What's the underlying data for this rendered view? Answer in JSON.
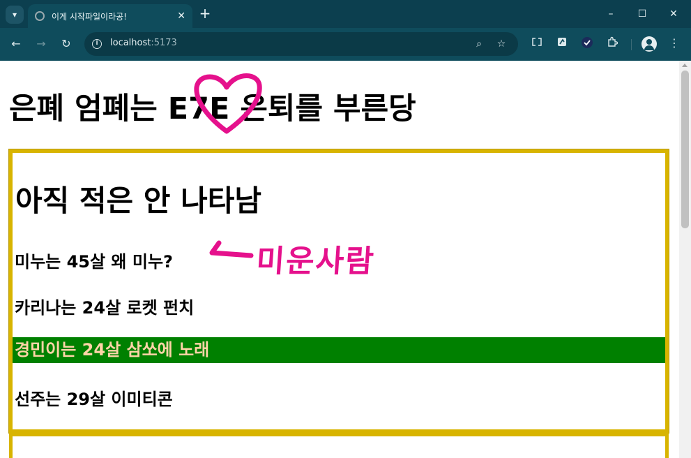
{
  "browser": {
    "tab_title": "이게 시작파일이라공!",
    "url_host": "localhost",
    "url_port": ":5173",
    "icons": {
      "tab_search": "chevron-down-icon",
      "new_tab": "+",
      "minimize": "–",
      "maximize": "☐",
      "close": "✕",
      "tab_close": "✕",
      "back": "←",
      "forward": "→",
      "reload": "↻",
      "info": "i",
      "zoom": "⌕",
      "bookmark": "☆",
      "menu": "⋮"
    }
  },
  "page": {
    "title": "은폐 엄폐는 E7E 은퇴를 부른당",
    "card": {
      "heading": "아직 적은 안 나타남",
      "members": [
        "미누는 45살 왜 미누?",
        "카리나는 24살 로켓 펀치",
        "경민이는 24살 삼쏘에 노래",
        "선주는 29살 이미티콘"
      ]
    },
    "annotation": {
      "text": "미운사람",
      "color": "#e5118c"
    }
  },
  "colors": {
    "titlebar": "#0c3f4f",
    "toolbar": "#0f4c5c",
    "card_border": "#d8b400",
    "highlight_bg": "#008000",
    "highlight_text": "#ffd5a8"
  }
}
